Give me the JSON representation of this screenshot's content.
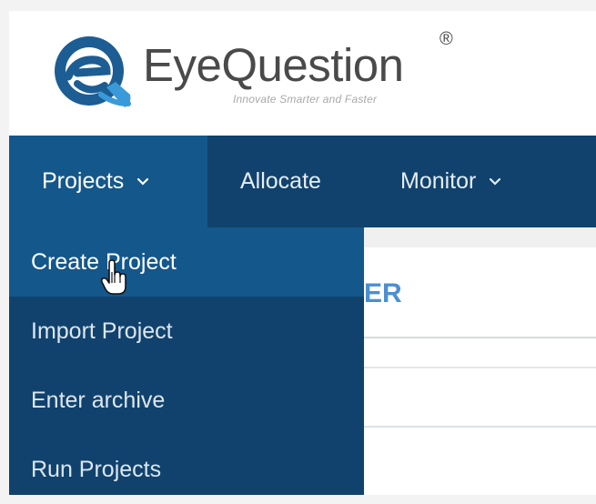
{
  "brand": {
    "name": "EyeQuestion",
    "registered_mark": "®",
    "tagline": "Innovate Smarter and Faster"
  },
  "nav": {
    "items": [
      {
        "label": "Projects",
        "has_dropdown": true,
        "active": true
      },
      {
        "label": "Allocate",
        "has_dropdown": false
      },
      {
        "label": "Monitor",
        "has_dropdown": true
      }
    ]
  },
  "dropdown": {
    "items": [
      {
        "label": "Create Project",
        "hovered": true
      },
      {
        "label": "Import Project"
      },
      {
        "label": "Enter archive"
      },
      {
        "label": "Run Projects"
      }
    ]
  },
  "content": {
    "heading_fragment": "ER"
  },
  "colors": {
    "nav_bg": "#10426d",
    "nav_active_bg": "#14578b",
    "logo_blue": "#1c5d93",
    "logo_light_blue": "#3a9ad9",
    "heading_blue": "#4c8fd0"
  }
}
